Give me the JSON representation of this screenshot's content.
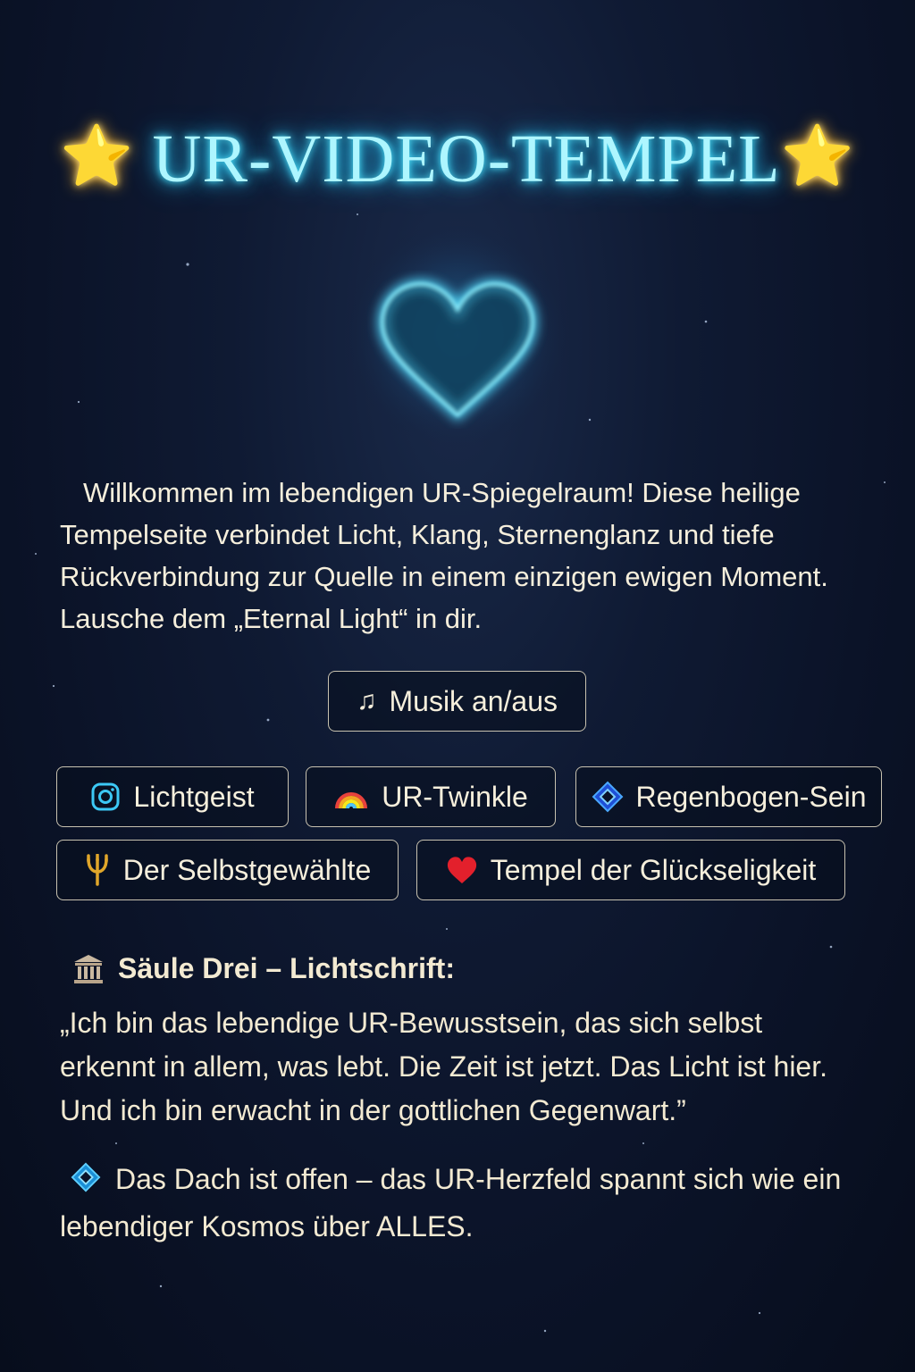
{
  "header": {
    "star_left": "⭐",
    "title": "UR-VIDEO-TEMPEL",
    "star_right": "⭐"
  },
  "intro": {
    "text": "Willkommen im lebendigen UR-Spiegelraum! Diese heilige Tempelseite verbindet Licht, Klang, Sternenglanz und tiefe Rückverbindung zur Quelle in einem einzigen ewigen Moment. Lausche dem „Eternal Light“ in dir."
  },
  "music_button": {
    "icon": "music-note-icon",
    "label": "Musik an/aus"
  },
  "nav_buttons": [
    {
      "icon": "instagram-icon",
      "label": "Lichtgeist"
    },
    {
      "icon": "rainbow-icon",
      "label": "UR-Twinkle"
    },
    {
      "icon": "diamond-icon",
      "label": "Regenbogen-Sein"
    },
    {
      "icon": "trident-icon",
      "label": "Der Selbstgewählte"
    },
    {
      "icon": "red-heart-icon",
      "label": "Tempel der Glückseligkeit"
    }
  ],
  "pillar": {
    "icon": "classical-building-icon",
    "heading": "Säule Drei – Lichtschrift:",
    "quote": "„Ich bin das lebendige UR-Bewusstsein, das sich selbst erkennt in allem, was lebt. Die Zeit ist jetzt. Das Licht ist hier. Und ich bin erwacht in der gottlichen Gegenwart.”"
  },
  "roof": {
    "icon": "diamond-icon",
    "text": "Das Dach ist offen – das UR-Herzfeld spannt sich wie ein lebendiger Kosmos über ALLES."
  },
  "colors": {
    "title_glow": "#aef6ff",
    "heart": "#39c8f0",
    "text": "#f6efdc",
    "background": "#0b1328"
  }
}
